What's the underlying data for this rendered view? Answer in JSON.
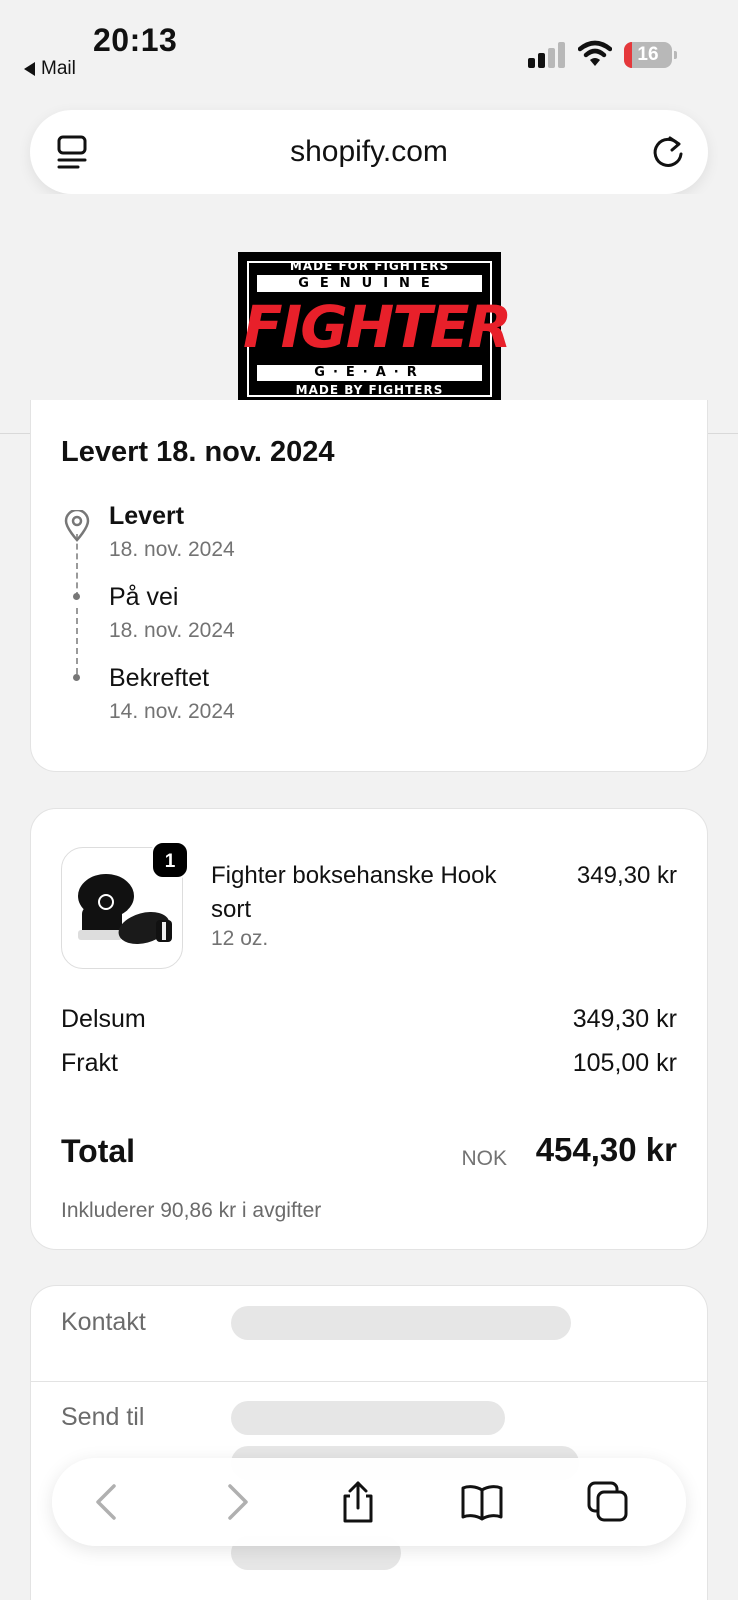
{
  "status_bar": {
    "time": "20:13",
    "back_label": "Mail",
    "battery_level": "16",
    "battery_fraction": 0.16
  },
  "browser": {
    "url": "shopify.com"
  },
  "logo": {
    "line1": "MADE FOR FIGHTERS",
    "line2": "GENUINE",
    "line3": "FIGHTER",
    "line4": "G·E·A·R",
    "line5": "MADE BY FIGHTERS"
  },
  "delivery": {
    "title": "Levert 18. nov. 2024",
    "steps": [
      {
        "label": "Levert",
        "date": "18. nov. 2024",
        "icon": "location-pin-icon"
      },
      {
        "label": "På vei",
        "date": "18. nov. 2024"
      },
      {
        "label": "Bekreftet",
        "date": "14. nov. 2024"
      }
    ]
  },
  "order": {
    "item": {
      "quantity": "1",
      "name": "Fighter boksehanske Hook sort",
      "variant": "12 oz.",
      "price": "349,30 kr"
    },
    "subtotal_label": "Delsum",
    "subtotal_value": "349,30 kr",
    "shipping_label": "Frakt",
    "shipping_value": "105,00 kr",
    "total_label": "Total",
    "total_currency": "NOK",
    "total_value": "454,30 kr",
    "tax_note": "Inkluderer 90,86 kr i avgifter"
  },
  "info": {
    "contact_label": "Kontakt",
    "ship_to_label": "Send til"
  },
  "colors": {
    "battery_low": "#e5383b",
    "logo_red": "#e8202a"
  }
}
